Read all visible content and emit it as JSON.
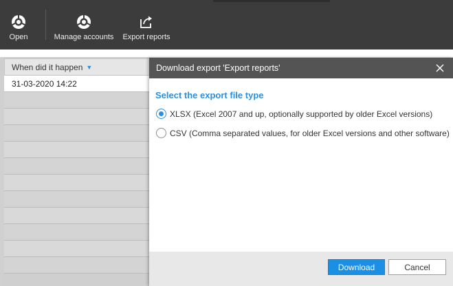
{
  "toolbar": {
    "buttons": [
      {
        "label": "Open",
        "icon": "open-icon"
      },
      {
        "label": "Manage accounts",
        "icon": "manage-accounts-icon"
      },
      {
        "label": "Export reports",
        "icon": "export-icon"
      }
    ]
  },
  "grid": {
    "column_header": "When did it happen",
    "sort_indicator": "▼",
    "rows": [
      "31-03-2020 14:22",
      "",
      "",
      "",
      "",
      "",
      "",
      "",
      "",
      "",
      "",
      ""
    ]
  },
  "dialog": {
    "title": "Download export 'Export reports'",
    "section_title": "Select the export file type",
    "options": [
      {
        "label": "XLSX (Excel 2007 and up, optionally supported by older Excel versions)",
        "checked": true
      },
      {
        "label": "CSV (Comma separated values, for older Excel versions and other software)",
        "checked": false
      }
    ],
    "download_label": "Download",
    "cancel_label": "Cancel"
  },
  "colors": {
    "toolbar_bg": "#3c3c3c",
    "dialog_header_bg": "#545454",
    "accent": "#2b8fe0",
    "primary_button": "#1a8fe3"
  }
}
